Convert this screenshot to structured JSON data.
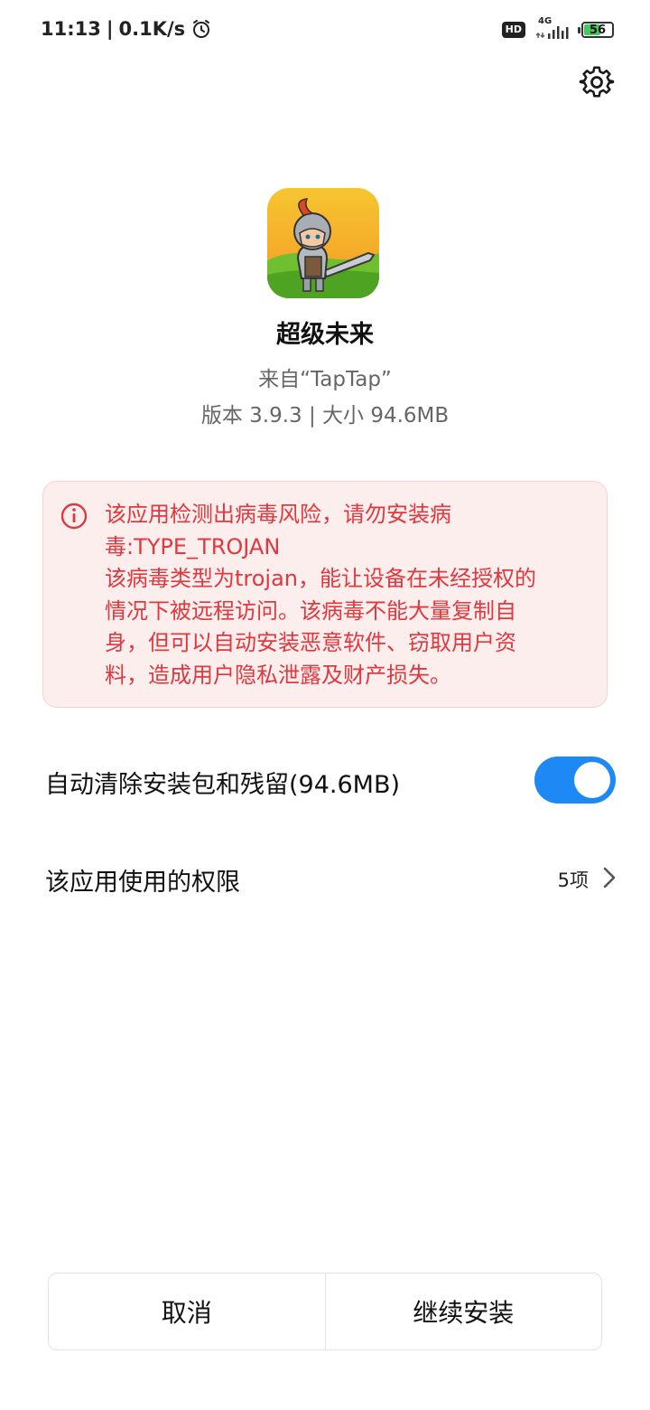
{
  "status_bar": {
    "time": "11:13",
    "separator": "|",
    "net_speed": "0.1K/s",
    "alarm_icon": "alarm-clock-icon",
    "hd_badge": "HD",
    "network_type": "4G",
    "signal_icon": "signal-bars-icon",
    "battery_level": "56",
    "battery_fraction": 0.56
  },
  "header": {
    "settings_icon": "gear-icon"
  },
  "app": {
    "icon": "knight-warrior-app-icon",
    "name": "超级未来",
    "source": "来自“TapTap”",
    "version_info": "版本 3.9.3 | 大小 94.6MB"
  },
  "warning": {
    "icon": "info-circle-icon",
    "lines": [
      "该应用检测出病毒风险，请勿安装病",
      "毒:TYPE_TROJAN",
      "该病毒类型为trojan，能让设备在未经授权的",
      "情况下被远程访问。该病毒不能大量复制自",
      "身，但可以自动安装恶意软件、窃取用户资",
      "料，造成用户隐私泄露及财产损失。"
    ],
    "color": "#e0383e"
  },
  "options": {
    "auto_clean_label": "自动清除安装包和残留(94.6MB)",
    "auto_clean_enabled": true,
    "permissions_label": "该应用使用的权限",
    "permissions_count": "5项",
    "chevron_icon": "chevron-right-icon"
  },
  "buttons": {
    "cancel": "取消",
    "continue": "继续安装"
  },
  "colors": {
    "accent": "#1e88f5",
    "warning_bg": "#fdeeee",
    "warning_text": "#e0383e"
  }
}
